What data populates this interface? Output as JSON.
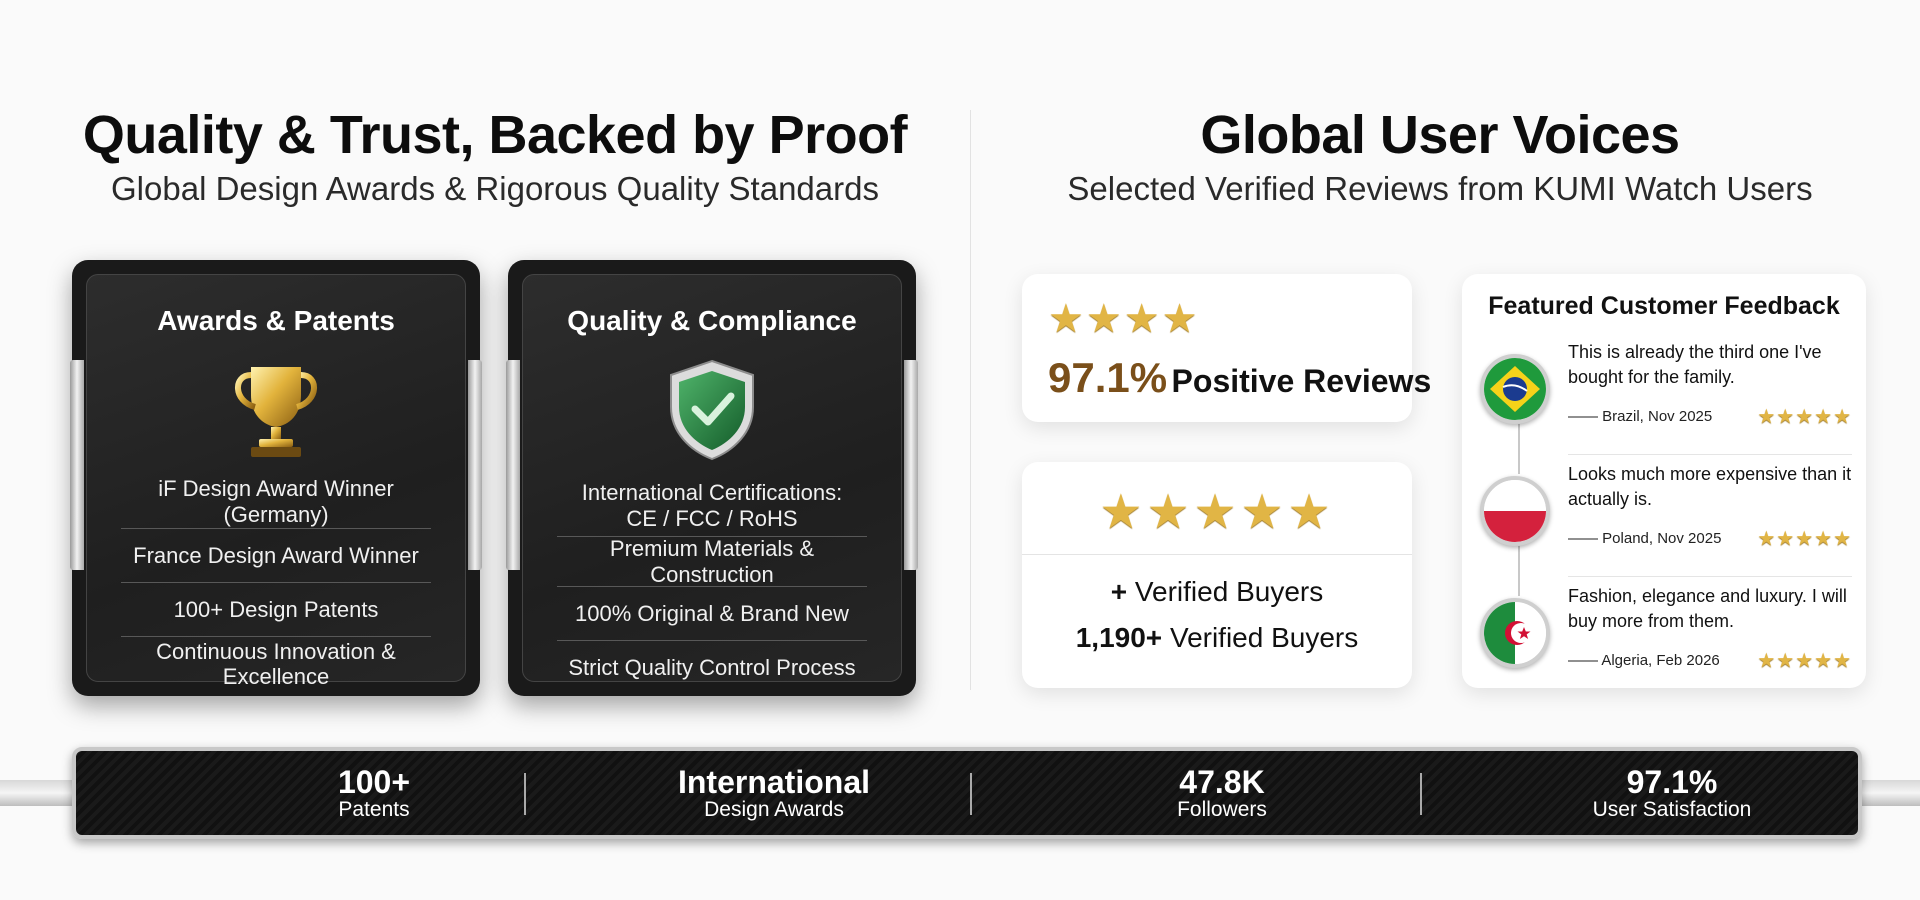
{
  "left": {
    "title": "Quality & Trust, Backed by Proof",
    "subtitle": "Global Design Awards & Rigorous Quality Standards",
    "awards_card": {
      "title": "Awards & Patents",
      "icon": "trophy-icon",
      "rows": [
        "iF Design Award Winner (Germany)",
        "France Design Award Winner",
        "100+ Design Patents",
        "Continuous Innovation & Excellence"
      ]
    },
    "quality_card": {
      "title": "Quality & Compliance",
      "icon": "shield-check-icon",
      "cert_line1": "International Certifications:",
      "cert_line2": "CE / FCC / RoHS",
      "rows": [
        "Premium Materials & Construction",
        "100% Original & Brand New",
        "Strict Quality Control Process"
      ]
    }
  },
  "right": {
    "title": "Global User Voices",
    "subtitle": "Selected Verified Reviews from KUMI Watch Users",
    "positive": {
      "stars": "★★★★",
      "percent": "97.1%",
      "label": "Positive Reviews"
    },
    "buyers": {
      "stars": "★★★★★",
      "line1_prefix": "+",
      "line1_label": "Verified Buyers",
      "line2_count": "1,190+",
      "line2_label": "Verified Buyers"
    },
    "feedback": {
      "title": "Featured Customer Feedback",
      "items": [
        {
          "text": "This is already the third one I've bought for the family.",
          "meta": "—— Brazil, Nov 2025",
          "stars": "★★★★★",
          "flag": "brazil-flag-icon"
        },
        {
          "text": "Looks much more expensive than it actually is.",
          "meta": "—— Poland, Nov 2025",
          "stars": "★★★★★",
          "flag": "poland-flag-icon"
        },
        {
          "text": "Fashion, elegance and luxury. I will buy more from them.",
          "meta": "—— Algeria, Feb 2026",
          "stars": "★★★★★",
          "flag": "algeria-flag-icon"
        }
      ]
    }
  },
  "stats": [
    {
      "value": "100+",
      "label": "Patents"
    },
    {
      "value": "International",
      "label": "Design Awards"
    },
    {
      "value": "47.8K",
      "label": "Followers"
    },
    {
      "value": "97.1%",
      "label": "User Satisfaction"
    }
  ],
  "colors": {
    "star": "#e1b545",
    "percent": "#7a4f1a",
    "card_dark": "#1a1a1a"
  }
}
